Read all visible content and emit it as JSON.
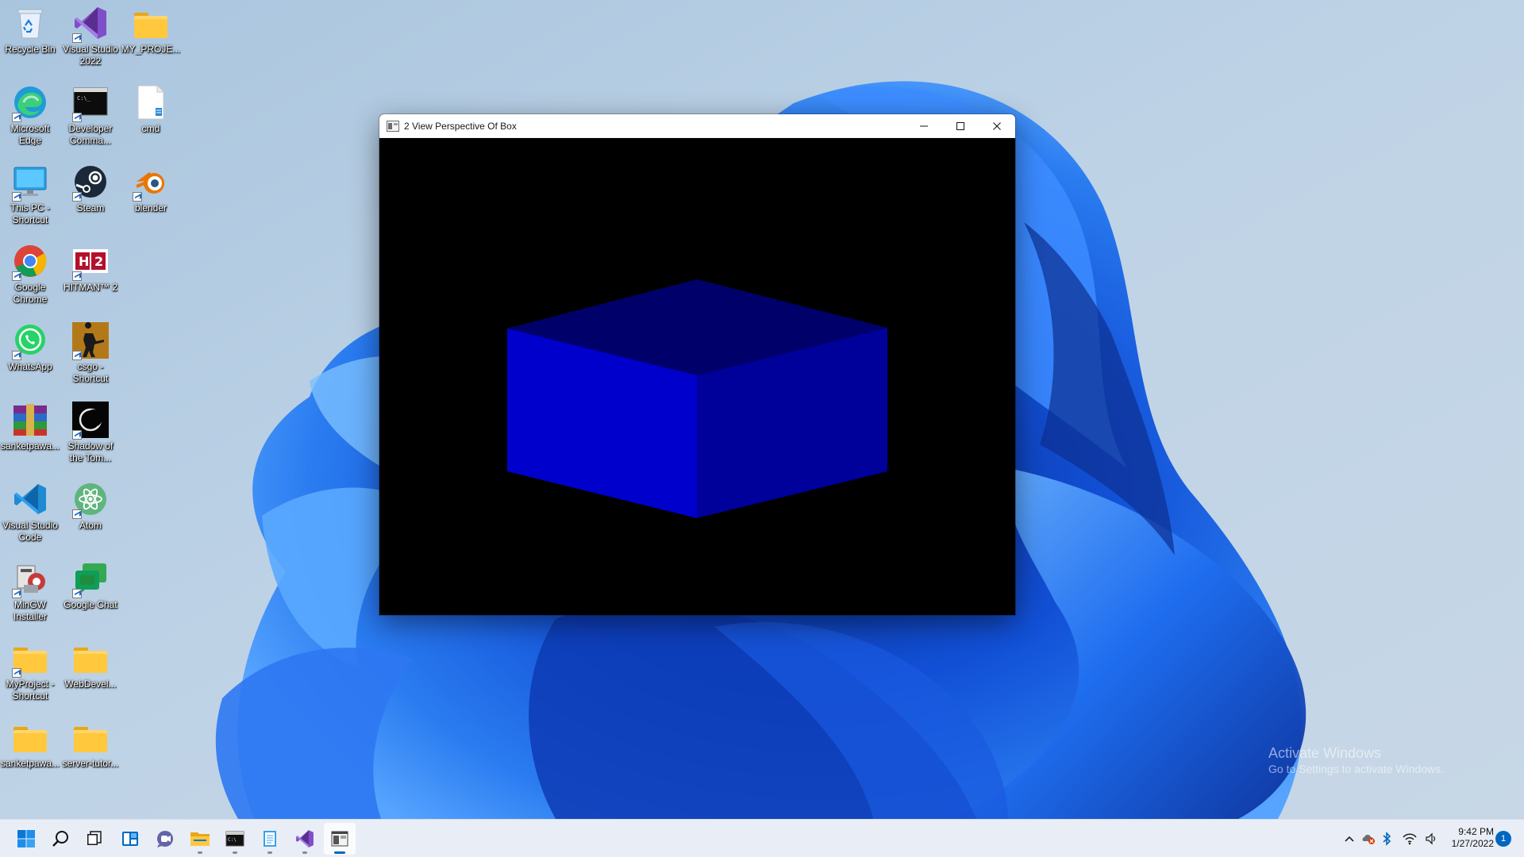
{
  "desktop": {
    "icons": [
      {
        "label": "Recycle Bin",
        "icon": "recycle-bin-icon"
      },
      {
        "label": "Visual Studio 2022",
        "icon": "visual-studio-icon"
      },
      {
        "label": "MY_PROJE...",
        "icon": "folder-icon"
      },
      {
        "label": "Microsoft Edge",
        "icon": "edge-icon"
      },
      {
        "label": "Developer Comma...",
        "icon": "terminal-icon"
      },
      {
        "label": "cmd",
        "icon": "text-file-icon"
      },
      {
        "label": "This PC - Shortcut",
        "icon": "monitor-icon"
      },
      {
        "label": "Steam",
        "icon": "steam-icon"
      },
      {
        "label": "blender",
        "icon": "blender-icon"
      },
      {
        "label": "Google Chrome",
        "icon": "chrome-icon"
      },
      {
        "label": "HITMAN™ 2",
        "icon": "hitman-icon"
      },
      {
        "label": "WhatsApp",
        "icon": "whatsapp-icon"
      },
      {
        "label": "csgo - Shortcut",
        "icon": "csgo-icon"
      },
      {
        "label": "sanketpawa...",
        "icon": "winrar-icon"
      },
      {
        "label": "Shadow of the Tom...",
        "icon": "game-icon"
      },
      {
        "label": "Visual Studio Code",
        "icon": "vscode-icon"
      },
      {
        "label": "Atom",
        "icon": "atom-icon"
      },
      {
        "label": "MinGW Installer",
        "icon": "installer-icon"
      },
      {
        "label": "Google Chat",
        "icon": "google-chat-icon"
      },
      {
        "label": "MyProject - Shortcut",
        "icon": "folder-icon"
      },
      {
        "label": "WebDevel...",
        "icon": "folder-icon"
      },
      {
        "label": "sanketpawa...",
        "icon": "folder-icon"
      },
      {
        "label": "server-tutor...",
        "icon": "folder-icon"
      }
    ]
  },
  "window": {
    "title": "2 View Perspective Of Box",
    "minimize_icon": "minimize-icon",
    "maximize_icon": "maximize-icon",
    "close_icon": "close-icon",
    "canvas_background": "#000000",
    "box_colors": {
      "top": "#00006b",
      "left": "#0000cd",
      "right": "#00009a"
    }
  },
  "watermark": {
    "line1": "Activate Windows",
    "line2": "Go to Settings to activate Windows."
  },
  "taskbar": {
    "apps": [
      {
        "name": "start",
        "icon": "windows-logo-icon"
      },
      {
        "name": "search",
        "icon": "search-icon"
      },
      {
        "name": "task-view",
        "icon": "task-view-icon"
      },
      {
        "name": "widgets",
        "icon": "widgets-icon"
      },
      {
        "name": "teams-chat",
        "icon": "chat-icon"
      },
      {
        "name": "file-explorer",
        "icon": "folder-icon"
      },
      {
        "name": "terminal",
        "icon": "terminal-icon"
      },
      {
        "name": "notepad",
        "icon": "notepad-icon"
      },
      {
        "name": "visual-studio",
        "icon": "visual-studio-icon"
      },
      {
        "name": "perspective-app",
        "icon": "app-window-icon",
        "active": true
      }
    ],
    "tray": {
      "icons": [
        "chevron-up-icon",
        "security-icon",
        "bluetooth-icon",
        "wifi-icon",
        "speaker-icon"
      ],
      "time": "9:42 PM",
      "date": "1/27/2022",
      "notification_count": "1"
    }
  }
}
